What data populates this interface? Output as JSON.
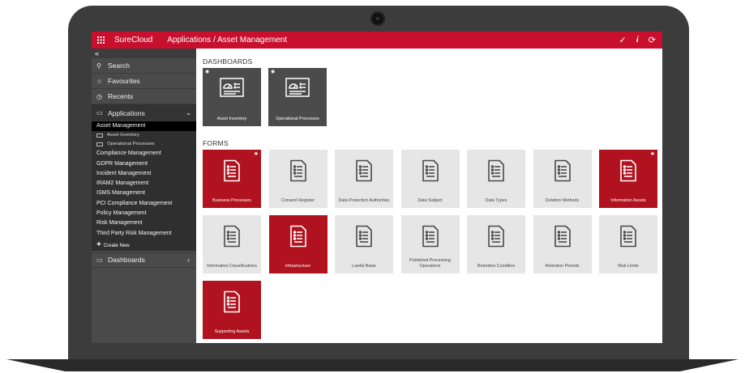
{
  "topbar": {
    "brand": "SureCloud",
    "title": "Applications / Asset Management",
    "tools": [
      "check-icon",
      "info-icon",
      "refresh-icon"
    ]
  },
  "sidebar": {
    "collapse": "«",
    "search": "Search",
    "favourites": "Favourites",
    "recents": "Recents",
    "applications": "Applications",
    "apps": [
      {
        "label": "Asset Management",
        "active": true
      },
      {
        "label": "Asset Inventory",
        "sub": true
      },
      {
        "label": "Operational Processes",
        "sub": true
      },
      {
        "label": "Compliance Management"
      },
      {
        "label": "GDPR Management"
      },
      {
        "label": "Incident Management"
      },
      {
        "label": "IRAM2 Management"
      },
      {
        "label": "ISMS Management"
      },
      {
        "label": "PCI Compliance Management"
      },
      {
        "label": "Policy Management"
      },
      {
        "label": "Risk Management"
      },
      {
        "label": "Third Party Risk Management"
      }
    ],
    "create_new": "Create New",
    "dashboards": "Dashboards"
  },
  "main": {
    "dashboards_title": "DASHBOARDS",
    "forms_title": "FORMS",
    "dashboards": [
      {
        "label": "Asset Inventory"
      },
      {
        "label": "Operational Processes"
      }
    ],
    "forms": [
      {
        "label": "Business Processes",
        "style": "red",
        "star": true
      },
      {
        "label": "Consent Register",
        "style": "grey"
      },
      {
        "label": "Data Protection Authorities",
        "style": "grey"
      },
      {
        "label": "Data Subject",
        "style": "grey"
      },
      {
        "label": "Data Types",
        "style": "grey"
      },
      {
        "label": "Deletion Methods",
        "style": "grey"
      },
      {
        "label": "Information Assets",
        "style": "red",
        "star": true
      },
      {
        "label": "Information Classifications",
        "style": "grey"
      },
      {
        "label": "Infrastructure",
        "style": "red"
      },
      {
        "label": "Lawful Basis",
        "style": "grey"
      },
      {
        "label": "Published Processing Operations",
        "style": "grey"
      },
      {
        "label": "Retention Condition",
        "style": "grey"
      },
      {
        "label": "Retention Periods",
        "style": "grey"
      },
      {
        "label": "Risk Limits",
        "style": "grey"
      },
      {
        "label": "Supporting Assets",
        "style": "red"
      }
    ],
    "star_glyph": "★",
    "eye_glyph": "👁"
  },
  "colors": {
    "brand": "#c8102e",
    "tile_red": "#b0131f",
    "tile_grey": "#e6e6e6",
    "tile_dark": "#4b4b4b",
    "sidebar": "#4a4a4a"
  }
}
